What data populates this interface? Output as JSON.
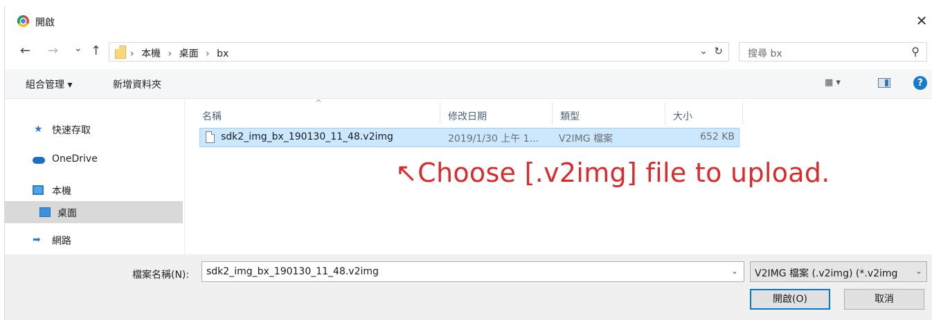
{
  "window": {
    "title": "開啟",
    "close_symbol": "✕"
  },
  "nav": {
    "back_symbol": "←",
    "forward_symbol": "→",
    "recent_symbol": "⌄",
    "up_symbol": "↑",
    "breadcrumbs": [
      "本機",
      "桌面",
      "bx"
    ],
    "separator": "›",
    "dropdown_symbol": "⌄",
    "refresh_symbol": "↻",
    "search_placeholder": "搜尋 bx",
    "search_symbol": "⚲"
  },
  "toolbar": {
    "organize_label": "組合管理 ▾",
    "new_folder_label": "新增資料夾",
    "view_symbol": "▦ ▾",
    "help_symbol": "?"
  },
  "sidebar": {
    "items": [
      {
        "label": "快速存取",
        "icon": "star-icon"
      },
      {
        "label": "OneDrive",
        "icon": "cloud-icon"
      },
      {
        "label": "本機",
        "icon": "computer-icon"
      },
      {
        "label": "桌面",
        "icon": "desktop-icon"
      },
      {
        "label": "網路",
        "icon": "network-icon"
      }
    ],
    "selected": "桌面",
    "star_symbol": "★",
    "network_symbol": "➡"
  },
  "files": {
    "columns": [
      "名稱",
      "修改日期",
      "類型",
      "大小"
    ],
    "sort_symbol": "^",
    "rows": [
      {
        "name": "sdk2_img_bx_190130_11_48.v2img",
        "modified": "2019/1/30 上午 1...",
        "type": "V2IMG 檔案",
        "size": "652 KB"
      }
    ]
  },
  "annotation": {
    "text": "↖Choose [.v2img] file to upload.",
    "color": "#d92b2b"
  },
  "footer": {
    "filename_label": "檔案名稱(N):",
    "filename_value": "sdk2_img_bx_190130_11_48.v2img",
    "filetype_value": "V2IMG 檔案 (.v2img) (*.v2img",
    "dropdown_symbol": "⌄",
    "open_button": "開啟(O)",
    "cancel_button": "取消"
  },
  "colors": {
    "accent": "#0078d7",
    "selection": "#cce8ff",
    "help": "#1979ca"
  }
}
